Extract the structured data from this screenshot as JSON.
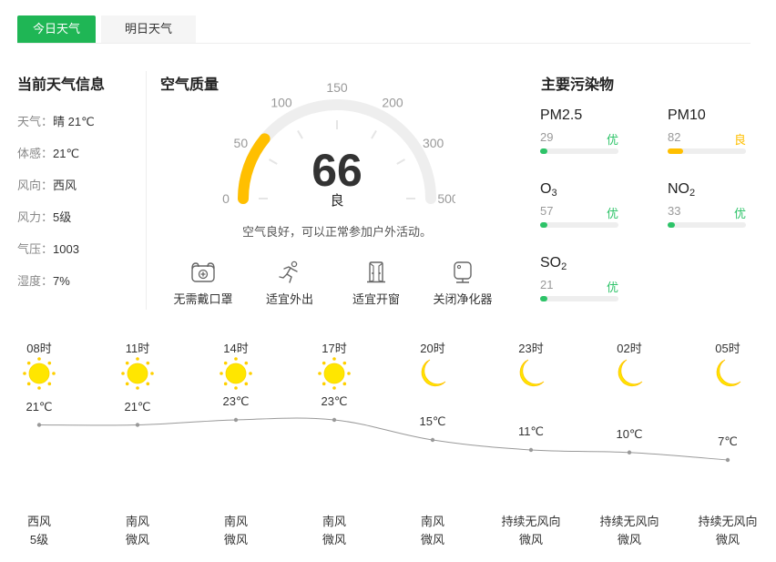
{
  "tabs": [
    {
      "label": "今日天气",
      "active": true
    },
    {
      "label": "明日天气",
      "active": false
    }
  ],
  "current": {
    "title": "当前天气信息",
    "rows": [
      {
        "label": "天气：",
        "value": "晴 21℃"
      },
      {
        "label": "体感：",
        "value": "21℃"
      },
      {
        "label": "风向：",
        "value": "西风"
      },
      {
        "label": "风力：",
        "value": "5级"
      },
      {
        "label": "气压：",
        "value": "1003"
      },
      {
        "label": "湿度：",
        "value": "7%"
      }
    ]
  },
  "air": {
    "title": "空气质量",
    "aqi": "66",
    "aqi_value": 66,
    "level": "良",
    "scale_ticks": [
      "0",
      "50",
      "100",
      "150",
      "200",
      "300",
      "500"
    ],
    "gauge_color": "#ffbf00",
    "track_color": "#eeeeee",
    "description": "空气良好，可以正常参加户外活动。",
    "advice": [
      {
        "label": "无需戴口罩",
        "icon": "mask-icon"
      },
      {
        "label": "适宜外出",
        "icon": "running-icon"
      },
      {
        "label": "适宜开窗",
        "icon": "window-icon"
      },
      {
        "label": "关闭净化器",
        "icon": "air-purifier-icon"
      }
    ]
  },
  "pollutants": {
    "title": "主要污染物",
    "items": [
      {
        "name": "PM2.5",
        "sub": "",
        "value": "29",
        "level": "优",
        "level_color": "#2dc368",
        "fill": 0.06
      },
      {
        "name": "PM10",
        "sub": "",
        "value": "82",
        "level": "良",
        "level_color": "#ffbf00",
        "fill": 0.2
      },
      {
        "name": "O",
        "sub": "3",
        "value": "57",
        "level": "优",
        "level_color": "#2dc368",
        "fill": 0.06
      },
      {
        "name": "NO",
        "sub": "2",
        "value": "33",
        "level": "优",
        "level_color": "#2dc368",
        "fill": 0.06
      },
      {
        "name": "SO",
        "sub": "2",
        "value": "21",
        "level": "优",
        "level_color": "#2dc368",
        "fill": 0.06
      }
    ]
  },
  "hourly": [
    {
      "time": "08时",
      "icon": "sun-icon",
      "temp": "21℃",
      "temp_value": 21,
      "wind_dir": "西风",
      "wind_level": "5级"
    },
    {
      "time": "11时",
      "icon": "sun-icon",
      "temp": "21℃",
      "temp_value": 21,
      "wind_dir": "南风",
      "wind_level": "微风"
    },
    {
      "time": "14时",
      "icon": "sun-icon",
      "temp": "23℃",
      "temp_value": 23,
      "wind_dir": "南风",
      "wind_level": "微风"
    },
    {
      "time": "17时",
      "icon": "sun-icon",
      "temp": "23℃",
      "temp_value": 23,
      "wind_dir": "南风",
      "wind_level": "微风"
    },
    {
      "time": "20时",
      "icon": "moon-icon",
      "temp": "15℃",
      "temp_value": 15,
      "wind_dir": "南风",
      "wind_level": "微风"
    },
    {
      "time": "23时",
      "icon": "moon-icon",
      "temp": "11℃",
      "temp_value": 11,
      "wind_dir": "持续无风向",
      "wind_level": "微风"
    },
    {
      "time": "02时",
      "icon": "moon-icon",
      "temp": "10℃",
      "temp_value": 10,
      "wind_dir": "持续无风向",
      "wind_level": "微风"
    },
    {
      "time": "05时",
      "icon": "moon-icon",
      "temp": "7℃",
      "temp_value": 7,
      "wind_dir": "持续无风向",
      "wind_level": "微风"
    }
  ],
  "colors": {
    "accent": "#1fb655",
    "sun": "#ffe600",
    "moon": "#ffe600",
    "good": "#2dc368",
    "moderate": "#ffbf00"
  }
}
